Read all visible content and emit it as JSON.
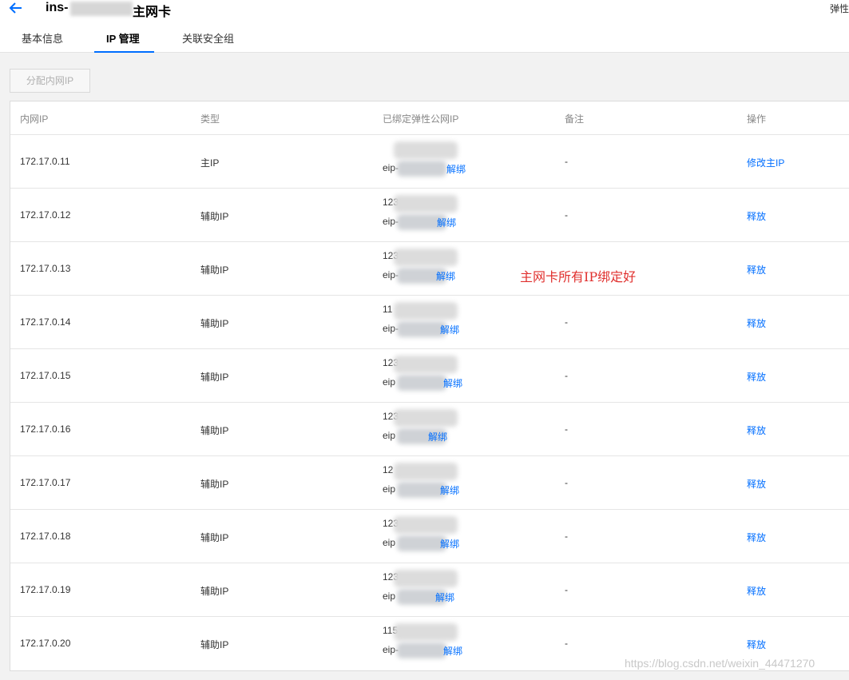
{
  "header": {
    "title_prefix": "ins-",
    "title_suffix": "主网卡",
    "right_text": "弹性"
  },
  "tabs": [
    {
      "label": "基本信息",
      "active": false
    },
    {
      "label": "IP 管理",
      "active": true
    },
    {
      "label": "关联安全组",
      "active": false
    }
  ],
  "toolbar": {
    "allocate_label": "分配内网IP"
  },
  "table": {
    "headers": [
      "内网IP",
      "类型",
      "已绑定弹性公网IP",
      "备注",
      "操作"
    ],
    "rows": [
      {
        "ip": "172.17.0.11",
        "type": "主IP",
        "eip_top": "",
        "eip_bottom": "eip-",
        "unbind": "解绑",
        "note": "-",
        "action": "修改主IP"
      },
      {
        "ip": "172.17.0.12",
        "type": "辅助IP",
        "eip_top": "123",
        "eip_bottom": "eip-",
        "unbind": "解绑",
        "note": "-",
        "action": "释放"
      },
      {
        "ip": "172.17.0.13",
        "type": "辅助IP",
        "eip_top": "123",
        "eip_bottom": "eip-",
        "unbind": "解绑",
        "note": "",
        "action": "释放"
      },
      {
        "ip": "172.17.0.14",
        "type": "辅助IP",
        "eip_top": "11",
        "eip_bottom": "eip-",
        "unbind": "解绑",
        "note": "-",
        "action": "释放"
      },
      {
        "ip": "172.17.0.15",
        "type": "辅助IP",
        "eip_top": "123",
        "eip_bottom": "eip",
        "unbind": "解绑",
        "note": "-",
        "action": "释放"
      },
      {
        "ip": "172.17.0.16",
        "type": "辅助IP",
        "eip_top": "123",
        "eip_bottom": "eip",
        "unbind": "解绑",
        "note": "-",
        "action": "释放"
      },
      {
        "ip": "172.17.0.17",
        "type": "辅助IP",
        "eip_top": "12",
        "eip_bottom": "eip",
        "unbind": "解绑",
        "note": "-",
        "action": "释放"
      },
      {
        "ip": "172.17.0.18",
        "type": "辅助IP",
        "eip_top": "123",
        "eip_bottom": "eip",
        "unbind": "解绑",
        "note": "-",
        "action": "释放"
      },
      {
        "ip": "172.17.0.19",
        "type": "辅助IP",
        "eip_top": "123",
        "eip_bottom": "eip",
        "unbind": "解绑",
        "note": "-",
        "action": "释放"
      },
      {
        "ip": "172.17.0.20",
        "type": "辅助IP",
        "eip_top": "115",
        "eip_bottom": "eip-",
        "unbind": "解绑",
        "note": "-",
        "action": "释放"
      }
    ]
  },
  "annotation": "主网卡所有IP绑定好",
  "watermark": "https://blog.csdn.net/weixin_44471270",
  "colors": {
    "accent": "#006eff",
    "annotation": "#e0302e"
  }
}
